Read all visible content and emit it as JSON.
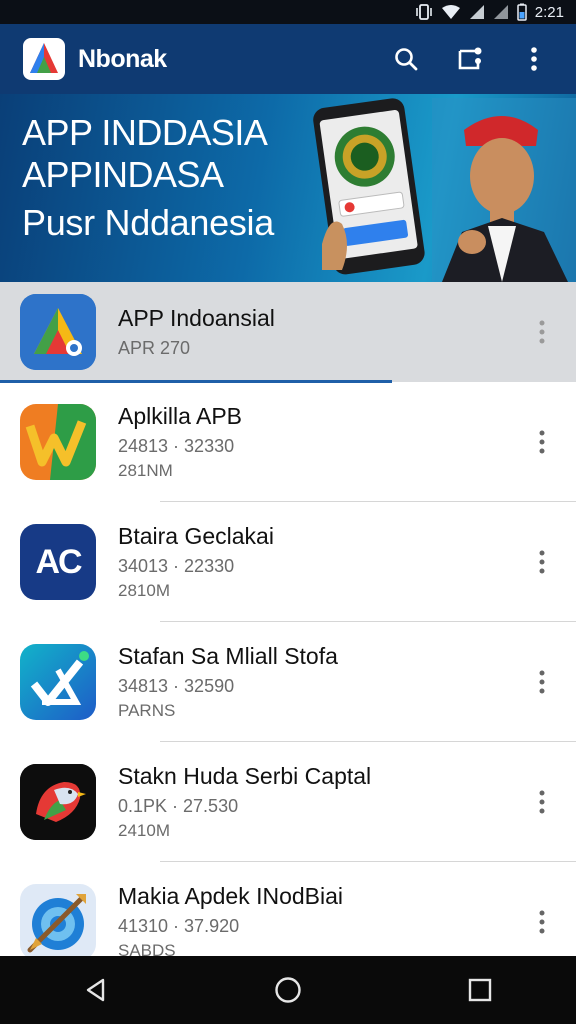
{
  "status_bar": {
    "time": "2:21"
  },
  "app_bar": {
    "title": "Nbonak"
  },
  "banner": {
    "line1": "APP INDDASIA",
    "line2": "APPINDASA",
    "line3": "Pusr Nddanesia"
  },
  "apps": [
    {
      "name": "APP Indoansial",
      "meta": "APR 270",
      "meta2": "",
      "icon": "triangle-logo-icon",
      "selected": true
    },
    {
      "name": "Aplkilla APB",
      "meta": "24813 · 32330",
      "meta2": "281NM",
      "icon": "w-logo-icon"
    },
    {
      "name": "Btaira Geclakai",
      "meta": "34013 · 22330",
      "meta2": "2810M",
      "icon": "ac-logo-icon",
      "icon_text": "AC"
    },
    {
      "name": "Stafan Sa Mliall Stofa",
      "meta": "34813 · 32590",
      "meta2": "PARNS",
      "icon": "check-triangle-icon"
    },
    {
      "name": "Stakn Huda Serbi Captal",
      "meta": "0.1PK · 27.530",
      "meta2": "2410M",
      "icon": "eagle-icon"
    },
    {
      "name": "Makia Apdek INodBiai",
      "meta": "41310 · 37.920",
      "meta2": "SABDS",
      "icon": "arrow-target-icon"
    }
  ],
  "progress": 0.68,
  "colors": {
    "appbar": "#0f3a72",
    "accent": "#1f5fa8",
    "selected_row": "#d9dbde"
  }
}
